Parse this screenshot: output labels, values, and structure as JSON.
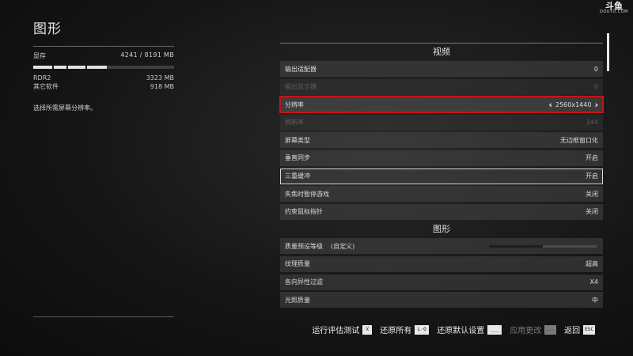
{
  "page_title": "图形",
  "watermark": {
    "main": "斗鱼",
    "sub": "DOUYU.COM"
  },
  "memory": {
    "label": "显存",
    "total": "4241 / 8191 MB",
    "used_fraction": 0.52,
    "usage": [
      {
        "name": "RDR2",
        "value": "3323 MB"
      },
      {
        "name": "其它软件",
        "value": "918 MB"
      }
    ]
  },
  "description": "选择所需屏幕分辨率。",
  "sections": {
    "video": {
      "title": "视频",
      "rows": [
        {
          "label": "输出适配器",
          "value": "0"
        },
        {
          "label": "输出显示器",
          "value": "0"
        },
        {
          "label": "分辨率",
          "value": "2560x1440"
        },
        {
          "label": "刷新率",
          "value": "144"
        },
        {
          "label": "屏幕类型",
          "value": "无边框窗口化"
        },
        {
          "label": "垂直同步",
          "value": "开启"
        },
        {
          "label": "三重缓冲",
          "value": "开启"
        },
        {
          "label": "失焦时暂停游戏",
          "value": "关闭"
        },
        {
          "label": "约束鼠标指针",
          "value": "关闭"
        }
      ]
    },
    "graphics": {
      "title": "图形",
      "rows": [
        {
          "label": "质量预设等级",
          "note": "(自定义)",
          "level_fraction": 0.5
        },
        {
          "label": "纹理质量",
          "value": "超高"
        },
        {
          "label": "各向异性过滤",
          "value": "X4"
        },
        {
          "label": "光照质量",
          "value": "中"
        }
      ]
    }
  },
  "footer": {
    "benchmark": {
      "label": "运行评估测试",
      "key": "X"
    },
    "reset_all": {
      "label": "还原所有",
      "key": "L·O"
    },
    "defaults": {
      "label": "还原默认设置",
      "key": "___"
    },
    "apply": {
      "label": "应用更改",
      "key": "..."
    },
    "back": {
      "label": "返回",
      "key": "ESC"
    }
  }
}
